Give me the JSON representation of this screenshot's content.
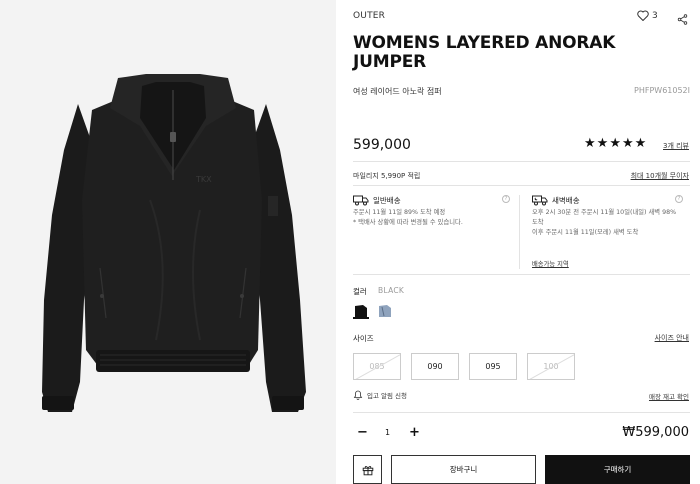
{
  "product": {
    "category": "OUTER",
    "like_count": "3",
    "title": "WOMENS LAYERED ANORAK JUMPER",
    "korean_name": "여성 레이어드 아노락 점퍼",
    "code": "PHFPW61052I",
    "price": "599,000",
    "rating_stars": 5,
    "review_link": "3개 리뷰",
    "image_alt": "black layered anorak jumper"
  },
  "mileage": {
    "text": "마일리지 5,990P 적립",
    "link": "최대 10개월 무이자"
  },
  "shipping": {
    "standard": {
      "title": "일반배송",
      "line1": "주문시 11월 11일 89% 도착 예정",
      "line2": "* 택배사 상황에 따라 변경될 수 있습니다."
    },
    "dawn": {
      "title": "새벽배송",
      "line1": "오후 2시 30분 전 주문시 11월 10일(내일) 새벽 98%",
      "line2": "도착",
      "line3": "이후 주문시 11월 11일(모레) 새벽 도착"
    },
    "area_link": "배송가능 지역"
  },
  "color": {
    "label": "컬러",
    "selected": "BLACK",
    "swatches": [
      "black",
      "denim-blue"
    ]
  },
  "size": {
    "label": "사이즈",
    "guide_link": "사이즈 안내",
    "options": [
      {
        "label": "085",
        "sold_out": true
      },
      {
        "label": "090",
        "sold_out": false
      },
      {
        "label": "095",
        "sold_out": false
      },
      {
        "label": "100",
        "sold_out": true
      }
    ]
  },
  "restock": {
    "text": "입고 알림 신청",
    "store_link": "매장 재고 확인"
  },
  "order": {
    "quantity": "1",
    "minus": "−",
    "plus": "+",
    "total": "₩599,000",
    "cart_label": "장바구니",
    "buy_label": "구매하기"
  },
  "icons": [
    "heart-icon",
    "share-icon",
    "truck-icon",
    "dawn-truck-icon",
    "help-icon",
    "bell-icon",
    "gift-icon",
    "star-icon"
  ]
}
